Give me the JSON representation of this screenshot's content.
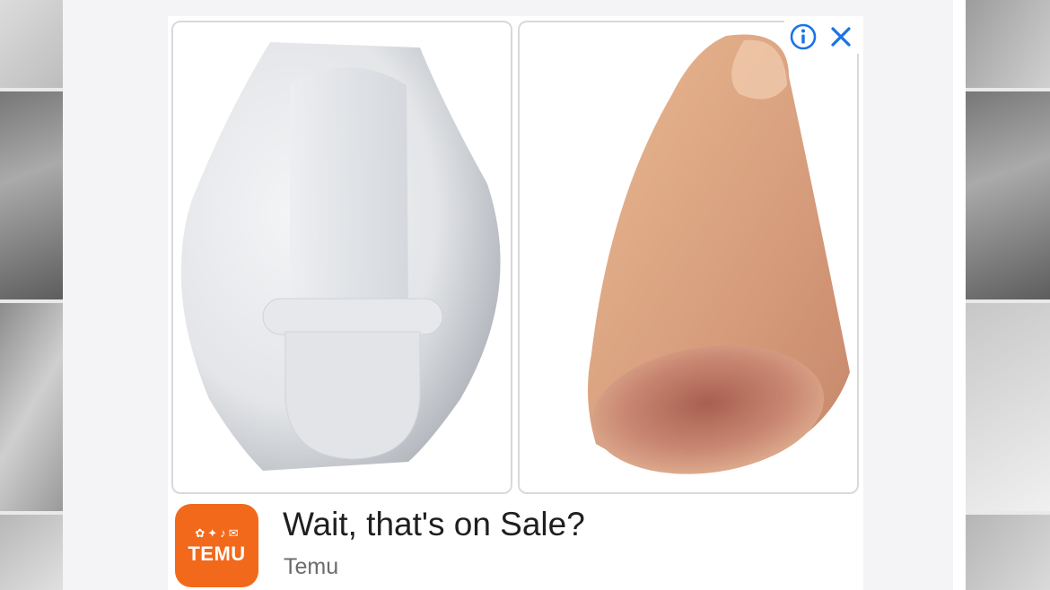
{
  "ad": {
    "headline": "Wait, that's on Sale?",
    "advertiser": "Temu",
    "logo_text": "TEMU",
    "logo_color": "#f2691b",
    "info_icon": "info-icon",
    "close_icon": "close-icon",
    "accent_color": "#1a73e8",
    "images": [
      {
        "name": "white-foam-pad",
        "color": "#e3e5e8"
      },
      {
        "name": "skin-tone-silicone-sleeve",
        "color": "#d9a17f"
      }
    ]
  }
}
